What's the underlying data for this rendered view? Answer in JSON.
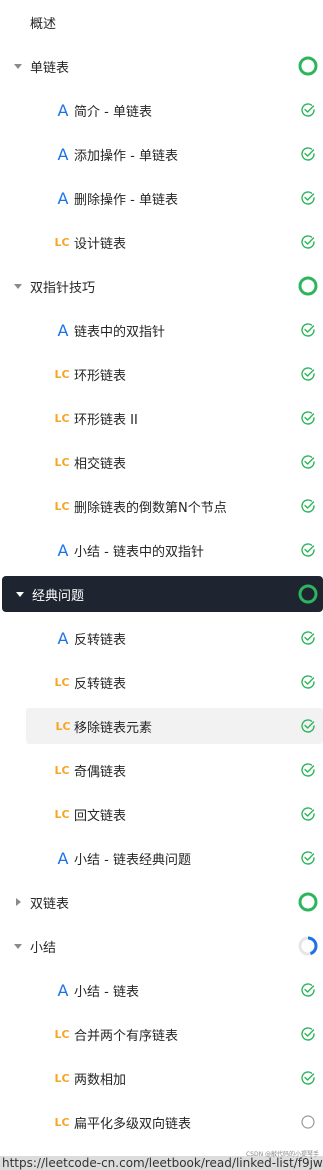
{
  "overview": "概述",
  "sections": [
    {
      "key": "s1",
      "title": "单链表",
      "progress": "complete",
      "lessons": [
        {
          "type": "A",
          "title": "简介 - 单链表",
          "status": "done"
        },
        {
          "type": "A",
          "title": "添加操作 - 单链表",
          "status": "done"
        },
        {
          "type": "A",
          "title": "删除操作 - 单链表",
          "status": "done"
        },
        {
          "type": "LC",
          "title": "设计链表",
          "status": "done"
        }
      ]
    },
    {
      "key": "s2",
      "title": "双指针技巧",
      "progress": "complete",
      "lessons": [
        {
          "type": "A",
          "title": "链表中的双指针",
          "status": "done"
        },
        {
          "type": "LC",
          "title": "环形链表",
          "status": "done"
        },
        {
          "type": "LC",
          "title": "环形链表 II",
          "status": "done"
        },
        {
          "type": "LC",
          "title": "相交链表",
          "status": "done"
        },
        {
          "type": "LC",
          "title": "删除链表的倒数第N个节点",
          "status": "done"
        },
        {
          "type": "A",
          "title": "小结 - 链表中的双指针",
          "status": "done"
        }
      ]
    },
    {
      "key": "s3",
      "title": "经典问题",
      "progress": "complete",
      "active": true,
      "lessons": [
        {
          "type": "A",
          "title": "反转链表",
          "status": "done"
        },
        {
          "type": "LC",
          "title": "反转链表",
          "status": "done"
        },
        {
          "type": "LC",
          "title": "移除链表元素",
          "status": "done",
          "hover": true
        },
        {
          "type": "LC",
          "title": "奇偶链表",
          "status": "done"
        },
        {
          "type": "LC",
          "title": "回文链表",
          "status": "done"
        },
        {
          "type": "A",
          "title": "小结 - 链表经典问题",
          "status": "done"
        }
      ]
    },
    {
      "key": "s4",
      "title": "双链表",
      "progress": "complete",
      "collapsed": true,
      "lessons": []
    },
    {
      "key": "s5",
      "title": "小结",
      "progress": "partial",
      "lessons": [
        {
          "type": "A",
          "title": "小结 - 链表",
          "status": "done"
        },
        {
          "type": "LC",
          "title": "合并两个有序链表",
          "status": "done"
        },
        {
          "type": "LC",
          "title": "两数相加",
          "status": "done"
        },
        {
          "type": "LC",
          "title": "扁平化多级双向链表",
          "status": "todo"
        }
      ]
    }
  ],
  "url": "https://leetcode-cn.com/leetbook/read/linked-list/f9jw...",
  "watermark": "CSDN @敲代码的小提琴手",
  "colors": {
    "done_green": "#2db55d",
    "partial_blue": "#1a73e8",
    "article_blue": "#1a73e8",
    "lc_orange": "#f5a623",
    "active_bg": "#1f2530"
  },
  "icons": {
    "caret_open": "caret-down-icon",
    "caret_closed": "caret-right-icon",
    "done": "check-circle-icon",
    "todo": "empty-circle-icon",
    "ring": "progress-ring-icon"
  }
}
